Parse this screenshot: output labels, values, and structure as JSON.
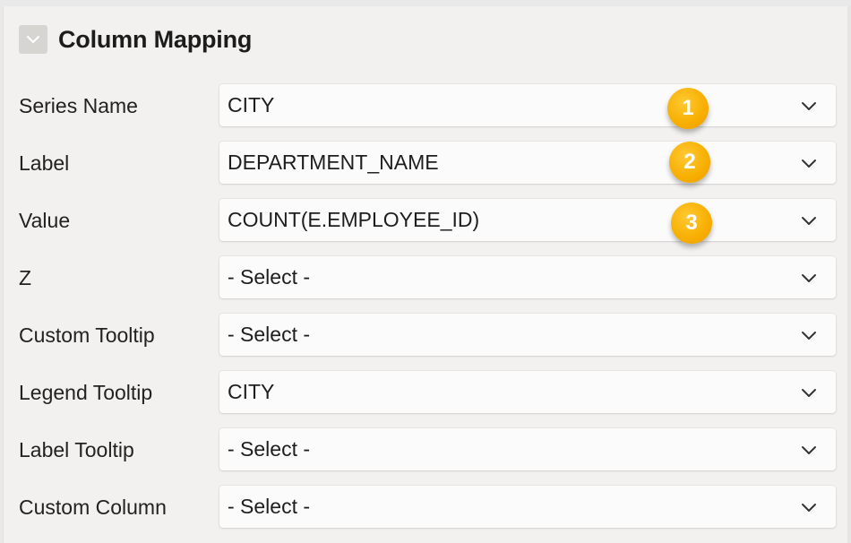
{
  "section": {
    "title": "Column Mapping",
    "collapse_icon": "chevron-down-icon"
  },
  "fields": [
    {
      "label": "Series Name",
      "value": "CITY"
    },
    {
      "label": "Label",
      "value": "DEPARTMENT_NAME"
    },
    {
      "label": "Value",
      "value": "COUNT(E.EMPLOYEE_ID)"
    },
    {
      "label": "Z",
      "value": "- Select -"
    },
    {
      "label": "Custom Tooltip",
      "value": "- Select -"
    },
    {
      "label": "Legend Tooltip",
      "value": "CITY"
    },
    {
      "label": "Label Tooltip",
      "value": "- Select -"
    },
    {
      "label": "Custom Column",
      "value": "- Select -"
    }
  ],
  "callouts": [
    {
      "number": "1"
    },
    {
      "number": "2"
    },
    {
      "number": "3"
    }
  ],
  "colors": {
    "callout_badge": "#f7ae00",
    "panel_background": "#f2f1f0",
    "select_background": "#fbfbfb"
  }
}
